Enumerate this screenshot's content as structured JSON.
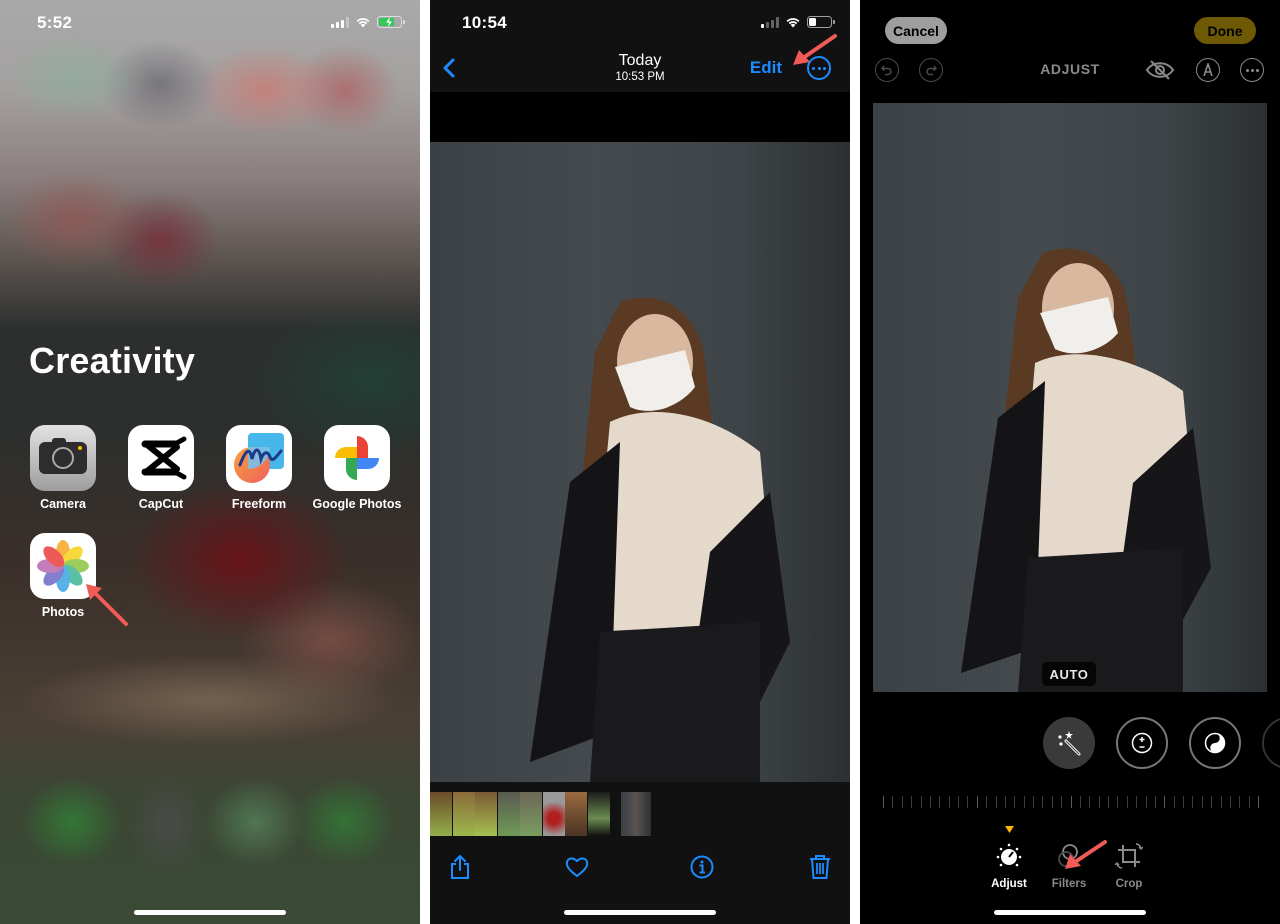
{
  "panel1": {
    "status": {
      "time": "5:52",
      "battery_charging": true,
      "battery_color": "#34c759"
    },
    "folder_title": "Creativity",
    "apps": [
      {
        "label": "Camera",
        "icon": "camera-icon"
      },
      {
        "label": "CapCut",
        "icon": "capcut-icon"
      },
      {
        "label": "Freeform",
        "icon": "freeform-icon"
      },
      {
        "label": "Google Photos",
        "icon": "google-photos-icon"
      },
      {
        "label": "Photos",
        "icon": "photos-icon"
      }
    ],
    "annotation": {
      "type": "arrow",
      "points_to": "Photos",
      "color": "#f05a57"
    }
  },
  "panel2": {
    "status": {
      "time": "10:54"
    },
    "nav": {
      "title": "Today",
      "subtitle": "10:53 PM",
      "edit_label": "Edit"
    },
    "accent": "#1a8cff",
    "thumbnail_count": 10,
    "toolbar": [
      "share-icon",
      "heart-icon",
      "info-icon",
      "trash-icon"
    ],
    "annotation": {
      "type": "arrow",
      "points_to": "Edit",
      "color": "#f05a57"
    }
  },
  "panel3": {
    "cancel_label": "Cancel",
    "done_label": "Done",
    "mode_title": "ADJUST",
    "auto_badge": "AUTO",
    "adjust_tools": [
      "auto-enhance-icon",
      "exposure-icon",
      "brilliance-icon"
    ],
    "tabs": [
      {
        "label": "Adjust",
        "active": true
      },
      {
        "label": "Filters",
        "active": false
      },
      {
        "label": "Crop",
        "active": false
      }
    ],
    "active_indicator_color": "#ffb800",
    "annotation": {
      "type": "arrow",
      "points_to": "Filters",
      "color": "#f05a57"
    }
  }
}
